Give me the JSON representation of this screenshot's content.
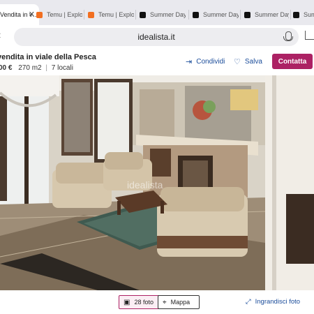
{
  "tabs": [
    {
      "label": "Vendita in v…",
      "favicon": "idealista-icon",
      "active": true
    },
    {
      "label": "Temu | Explo",
      "favicon": "temu-icon"
    },
    {
      "label": "Temu | Explo",
      "favicon": "temu-icon"
    },
    {
      "label": "Summer Day",
      "favicon": "summer-day-icon"
    },
    {
      "label": "Summer Day",
      "favicon": "summer-day-icon"
    },
    {
      "label": "Summer Day",
      "favicon": "summer-day-icon"
    },
    {
      "label": "Sum",
      "favicon": "summer-day-icon"
    }
  ],
  "address_bar": {
    "url": "idealista.it"
  },
  "listing": {
    "title": "vendita in viale della Pesca",
    "price": "00 €",
    "area": "270 m2",
    "rooms": "7 locali",
    "share_label": "Condividi",
    "save_label": "Salva",
    "contact_label": "Contatta"
  },
  "photo": {
    "watermark": "idealista"
  },
  "bottom_bar": {
    "photos_label": "28 foto",
    "map_label": "Mappa",
    "enlarge_label": "Ingrandisci foto"
  },
  "colors": {
    "brand": "#ac2164",
    "link": "#1a4c9a"
  }
}
